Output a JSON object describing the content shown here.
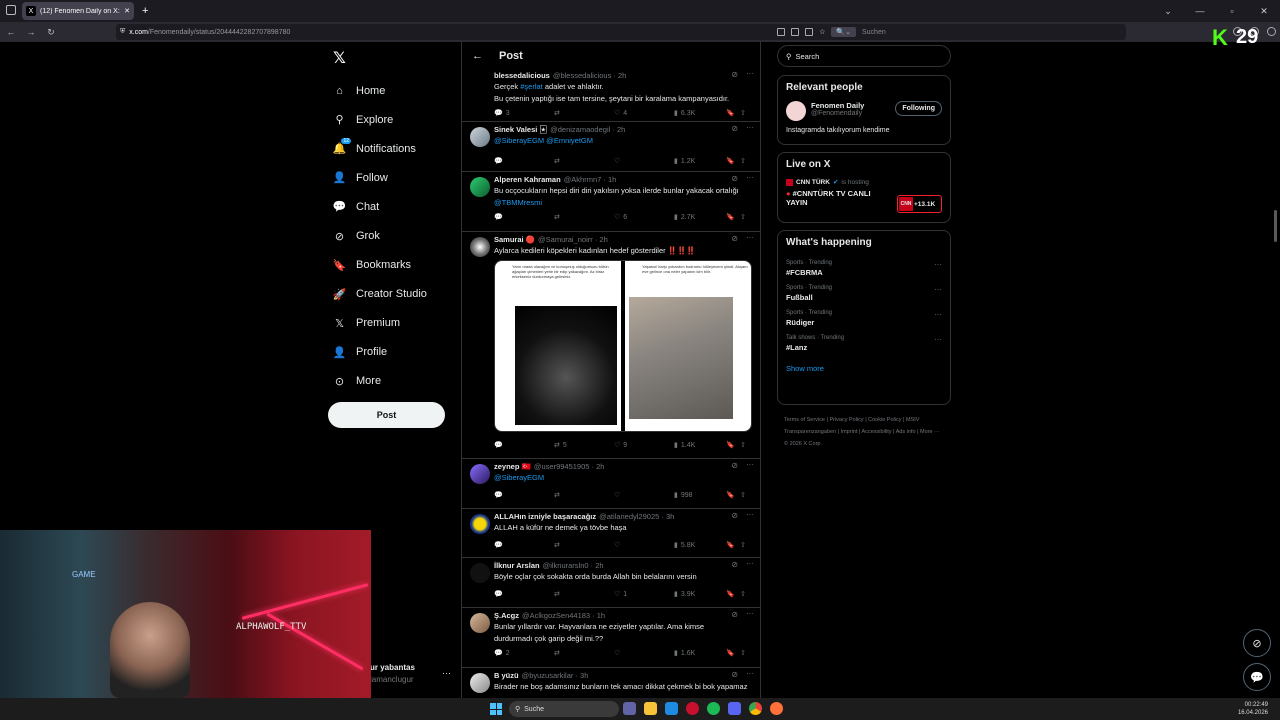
{
  "browser": {
    "tab_title": "(12) Fenomen Daily on X: \"SON...",
    "url_host": "x.com",
    "url_path": "/Fenomendaily/status/2044442282707898780",
    "search_placeholder": "Suchen"
  },
  "sidebar": {
    "items": [
      {
        "label": "Home"
      },
      {
        "label": "Explore"
      },
      {
        "label": "Notifications",
        "badge": "12"
      },
      {
        "label": "Follow"
      },
      {
        "label": "Chat"
      },
      {
        "label": "Grok"
      },
      {
        "label": "Bookmarks"
      },
      {
        "label": "Creator Studio"
      },
      {
        "label": "Premium"
      },
      {
        "label": "Profile"
      },
      {
        "label": "More"
      }
    ],
    "post_label": "Post",
    "account_name": "ur yabantas",
    "account_handle": "lamanclugur"
  },
  "main": {
    "header_title": "Post",
    "tweets": [
      {
        "name": "blessedalicious",
        "handle": "@blessedalicious · 2h",
        "text1": "Gerçek ",
        "tag": "#şerlat",
        "text1b": " adalet ve ahlaktır.",
        "text2": "Bu çetenin yaptığı ise tam tersine, şeytani bir karalama kampanyasıdır.",
        "replies": "3",
        "reposts": "",
        "likes": "4",
        "views": "6.3K"
      },
      {
        "name": "Sinek Valesi 🃏",
        "handle": "@denizamaodegil · 2h",
        "link": "@SiberayEGM @EmniyetGM",
        "replies": "",
        "reposts": "",
        "likes": "",
        "views": "1.2K"
      },
      {
        "name": "Alperen Kahraman",
        "handle": "@Akhrmn7 · 1h",
        "text1": "Bu ocçocukların hepsi diri diri yakılsın yoksa ilerde bunlar yakacak ortalığı",
        "link": "@TBMMresmi",
        "replies": "",
        "reposts": "",
        "likes": "6",
        "views": "2.7K"
      },
      {
        "name": "Samurai 🔴",
        "handle": "@Samurai_noirr · 2h",
        "text1": "Aylarca kedileri köpekleri kadınları hedef gösterdiler ‼️‼️‼️",
        "replies": "",
        "reposts": "5",
        "likes": "9",
        "views": "1.4K",
        "media_left": "Yarın orada olacağım ve konuşmuş olduğumuzu bütün ağaçları çimenleri yerle bir edip yakacağım. Az biraz erkekseniz durdurmaya gelirsiniz.",
        "media_right": "Yaşasın! karşı yokardım bodrumu hülleyecem şimdi. Akşam eve gelince ona neler yapanın kim bilir."
      },
      {
        "name": "zeynep 🇹🇷",
        "handle": "@user99451905 · 2h",
        "link": "@SiberayEGM",
        "replies": "",
        "reposts": "",
        "likes": "",
        "views": "998"
      },
      {
        "name": "ALLAHın izniyle başaracağız",
        "handle": "@atilanedyl29025 · 3h",
        "text1": "ALLAH a küfür ne demek ya tövbe haşa",
        "replies": "",
        "reposts": "",
        "likes": "",
        "views": "5.8K"
      },
      {
        "name": "İlknur Arslan",
        "handle": "@ilknurarsln0 · 2h",
        "text1": "Böyle oçlar çok sokakta orda burda Allah bin belalarını versin",
        "replies": "",
        "reposts": "",
        "likes": "1",
        "views": "3.9K"
      },
      {
        "name": "Ş.Acgz",
        "handle": "@AclkgozSen44183 · 1h",
        "text1": "Bunlar yıllardır var. Hayvanlara ne eziyetler yaptılar.  Ama kimse",
        "text2": "durdurmadı çok garip değil mi.??",
        "replies": "2",
        "reposts": "",
        "likes": "",
        "views": "1.6K"
      },
      {
        "name": "B yüzü",
        "handle": "@byuzusarkilar · 3h",
        "text1": "Birader ne boş adamsınız bunların tek amacı dikkat çekmek bi bok yapamaz"
      }
    ]
  },
  "right": {
    "search_placeholder": "Search",
    "relevant_title": "Relevant people",
    "person_name": "Fenomen Daily",
    "person_handle": "@Fenomendaily",
    "person_bio": "Instagramda takılıyorum kendime",
    "follow_label": "Following",
    "live_title": "Live on X",
    "live_host": "CNN TÜRK",
    "live_host_sub": "is hosting",
    "live_stream": "#CNNTÜRK TV CANLI YAYIN",
    "live_count": "+13.1K",
    "happening_title": "What's happening",
    "trends": [
      {
        "cat": "Sports · Trending",
        "tag": "#FCBRMA"
      },
      {
        "cat": "Sports · Trending",
        "tag": "Fußball"
      },
      {
        "cat": "Sports · Trending",
        "tag": "Rüdiger"
      },
      {
        "cat": "Talk shows · Trending",
        "tag": "#Lanz"
      }
    ],
    "show_more": "Show more",
    "footer": "Terms of Service  |  Privacy Policy  |  Cookie Policy  |  MStV Transparenzangaben  |  Imprint  |  Accessibility  |  Ads info  |  More ···  © 2026 X Corp."
  },
  "overlay": {
    "kick_count": "29",
    "wolf_tag": "ALPHAWOLF_TTV",
    "gamer_text": "GAME"
  },
  "taskbar": {
    "search_label": "Suche",
    "time": "00:22:49",
    "date": "16.04.2026"
  },
  "colors": {
    "accent": "#1d9bf0",
    "kick_green": "#53fc18",
    "live_red": "#f4212e"
  }
}
